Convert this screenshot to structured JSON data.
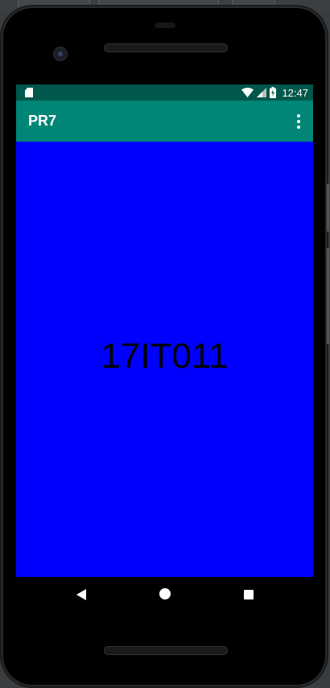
{
  "status_bar": {
    "time": "12:47",
    "icons": [
      "sd-card-icon",
      "wifi-icon",
      "cell-signal-icon",
      "battery-icon"
    ]
  },
  "app_bar": {
    "title": "PR7",
    "overflow_icon": "more-vert-icon"
  },
  "content": {
    "text": "17IT011",
    "background": "#0000ff"
  },
  "nav_bar": {
    "icons": [
      "back-icon",
      "home-icon",
      "recents-icon"
    ]
  },
  "colors": {
    "status_bar": "#00574b",
    "app_bar": "#008577",
    "content_bg": "#0000ff"
  }
}
